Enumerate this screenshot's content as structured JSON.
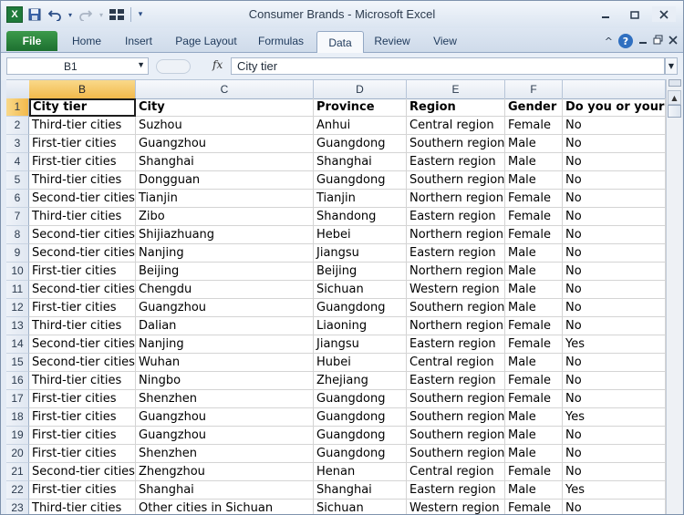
{
  "window": {
    "title": "Consumer Brands  -  Microsoft Excel",
    "minimize_icon": "minimize-icon",
    "maximize_icon": "restore-icon",
    "close_icon": "close-icon"
  },
  "ribbon": {
    "tabs": [
      {
        "label": "File"
      },
      {
        "label": "Home"
      },
      {
        "label": "Insert"
      },
      {
        "label": "Page Layout"
      },
      {
        "label": "Formulas"
      },
      {
        "label": "Data"
      },
      {
        "label": "Review"
      },
      {
        "label": "View"
      }
    ],
    "active_tab": "Data",
    "help_label": "?"
  },
  "formula_bar": {
    "name_box": "B1",
    "fx_label": "fx",
    "content": "City tier"
  },
  "grid": {
    "columns": [
      "B",
      "C",
      "D",
      "E",
      "F",
      ""
    ],
    "selected_column": "B",
    "rows": [
      {
        "n": "1",
        "cells": [
          "City tier",
          "City",
          "Province",
          "Region",
          "Gender",
          "Do you or your ho"
        ]
      },
      {
        "n": "2",
        "cells": [
          "Third-tier cities",
          "Suzhou",
          "Anhui",
          "Central region",
          "Female",
          "No"
        ]
      },
      {
        "n": "3",
        "cells": [
          "First-tier cities",
          "Guangzhou",
          "Guangdong",
          "Southern region",
          "Male",
          "No"
        ]
      },
      {
        "n": "4",
        "cells": [
          "First-tier cities",
          "Shanghai",
          "Shanghai",
          "Eastern region",
          "Male",
          "No"
        ]
      },
      {
        "n": "5",
        "cells": [
          "Third-tier cities",
          "Dongguan",
          "Guangdong",
          "Southern region",
          "Male",
          "No"
        ]
      },
      {
        "n": "6",
        "cells": [
          "Second-tier cities",
          "Tianjin",
          "Tianjin",
          "Northern region",
          "Female",
          "No"
        ]
      },
      {
        "n": "7",
        "cells": [
          "Third-tier cities",
          "Zibo",
          "Shandong",
          "Eastern region",
          "Female",
          "No"
        ]
      },
      {
        "n": "8",
        "cells": [
          "Second-tier cities",
          "Shijiazhuang",
          "Hebei",
          "Northern region",
          "Female",
          "No"
        ]
      },
      {
        "n": "9",
        "cells": [
          "Second-tier cities",
          "Nanjing",
          "Jiangsu",
          "Eastern region",
          "Male",
          "No"
        ]
      },
      {
        "n": "10",
        "cells": [
          "First-tier cities",
          "Beijing",
          "Beijing",
          "Northern region",
          "Male",
          "No"
        ]
      },
      {
        "n": "11",
        "cells": [
          "Second-tier cities",
          "Chengdu",
          "Sichuan",
          "Western region",
          "Male",
          "No"
        ]
      },
      {
        "n": "12",
        "cells": [
          "First-tier cities",
          "Guangzhou",
          "Guangdong",
          "Southern region",
          "Male",
          "No"
        ]
      },
      {
        "n": "13",
        "cells": [
          "Third-tier cities",
          "Dalian",
          "Liaoning",
          "Northern region",
          "Female",
          "No"
        ]
      },
      {
        "n": "14",
        "cells": [
          "Second-tier cities",
          "Nanjing",
          "Jiangsu",
          "Eastern region",
          "Female",
          "Yes"
        ]
      },
      {
        "n": "15",
        "cells": [
          "Second-tier cities",
          "Wuhan",
          "Hubei",
          "Central region",
          "Male",
          "No"
        ]
      },
      {
        "n": "16",
        "cells": [
          "Third-tier cities",
          "Ningbo",
          "Zhejiang",
          "Eastern region",
          "Female",
          "No"
        ]
      },
      {
        "n": "17",
        "cells": [
          "First-tier cities",
          "Shenzhen",
          "Guangdong",
          "Southern region",
          "Female",
          "No"
        ]
      },
      {
        "n": "18",
        "cells": [
          "First-tier cities",
          "Guangzhou",
          "Guangdong",
          "Southern region",
          "Male",
          "Yes"
        ]
      },
      {
        "n": "19",
        "cells": [
          "First-tier cities",
          "Guangzhou",
          "Guangdong",
          "Southern region",
          "Male",
          "No"
        ]
      },
      {
        "n": "20",
        "cells": [
          "First-tier cities",
          "Shenzhen",
          "Guangdong",
          "Southern region",
          "Male",
          "No"
        ]
      },
      {
        "n": "21",
        "cells": [
          "Second-tier cities",
          "Zhengzhou",
          "Henan",
          "Central region",
          "Female",
          "No"
        ]
      },
      {
        "n": "22",
        "cells": [
          "First-tier cities",
          "Shanghai",
          "Shanghai",
          "Eastern region",
          "Male",
          "Yes"
        ]
      },
      {
        "n": "23",
        "cells": [
          "Third-tier cities",
          "Other cities in Sichuan",
          "Sichuan",
          "Western region",
          "Female",
          "No"
        ]
      }
    ]
  },
  "colors": {
    "selection_header": "#f2b94b",
    "file_tab": "#1d7030",
    "excel_logo": "#1f7a3a"
  }
}
